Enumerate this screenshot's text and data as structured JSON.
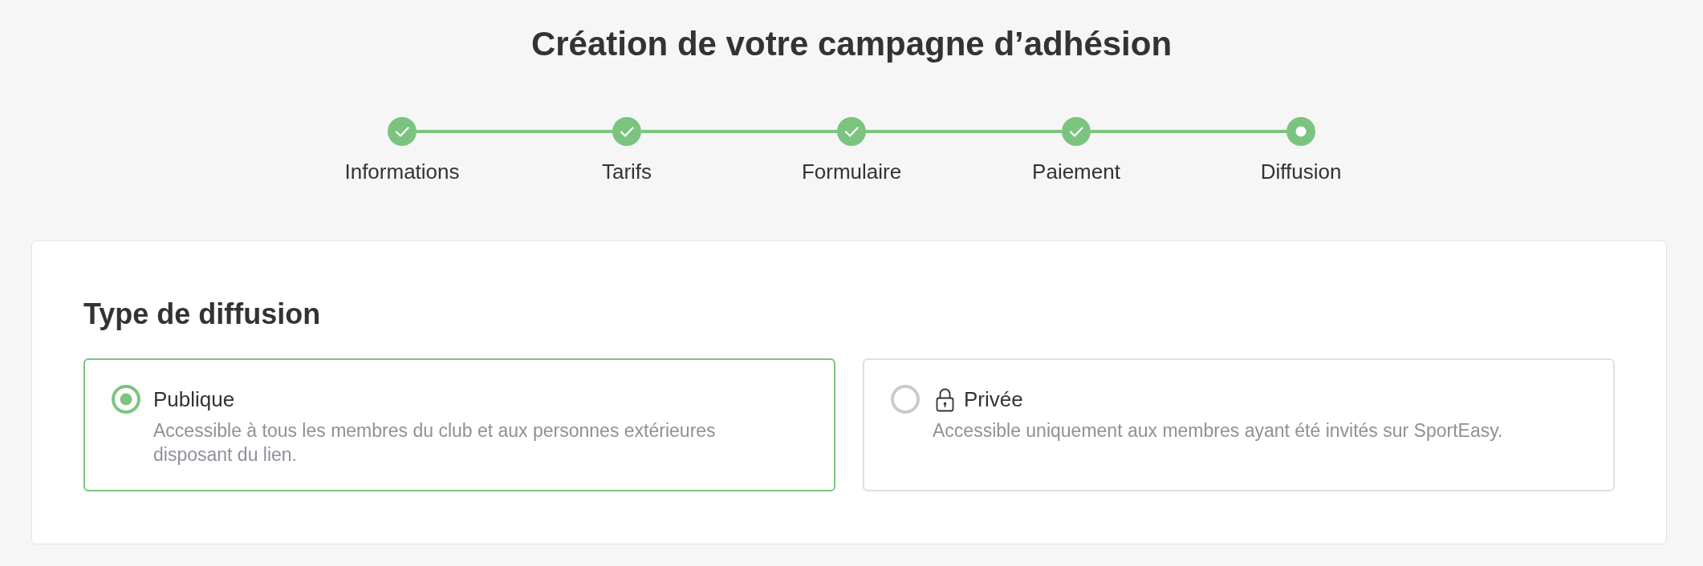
{
  "title": "Création de votre campagne d’adhésion",
  "steps": [
    {
      "label": "Informations",
      "completed": true,
      "current": false
    },
    {
      "label": "Tarifs",
      "completed": true,
      "current": false
    },
    {
      "label": "Formulaire",
      "completed": true,
      "current": false
    },
    {
      "label": "Paiement",
      "completed": true,
      "current": false
    },
    {
      "label": "Diffusion",
      "completed": false,
      "current": true
    }
  ],
  "section": {
    "title": "Type de diffusion",
    "options": [
      {
        "label": "Publique",
        "description": "Accessible à tous les membres du club et aux personnes extérieures disposant du lien.",
        "selected": true,
        "locked": false
      },
      {
        "label": "Privée",
        "description": "Accessible uniquement aux membres ayant été invités sur SportEasy.",
        "selected": false,
        "locked": true
      }
    ]
  }
}
